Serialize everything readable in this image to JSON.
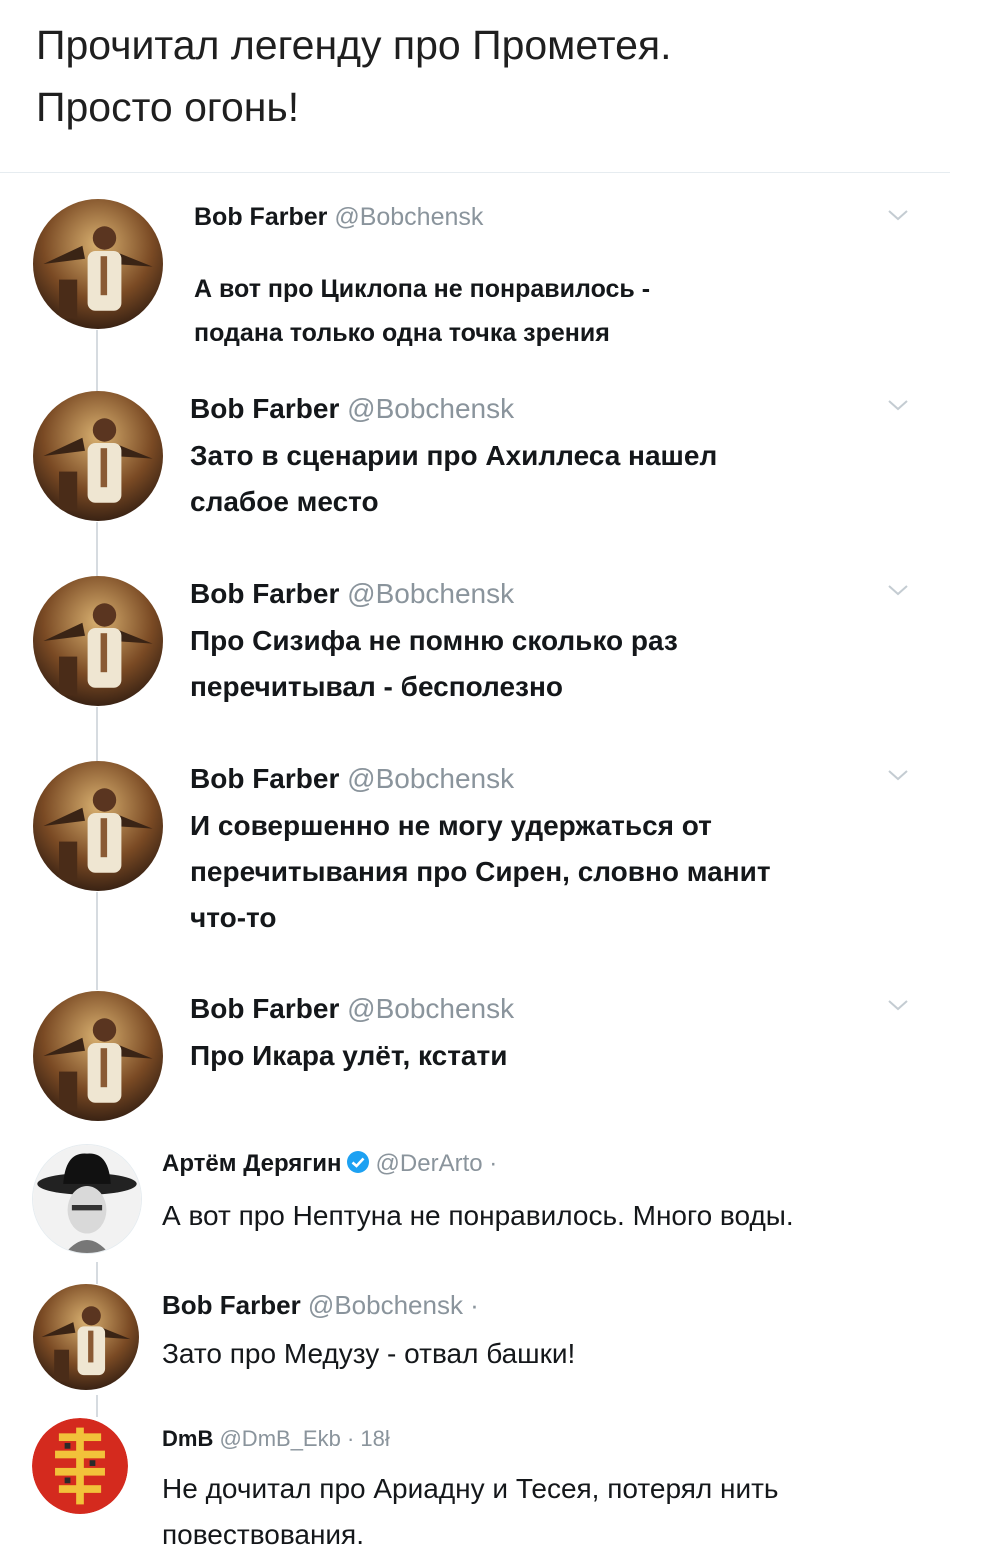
{
  "main_tweet": {
    "line1": "Прочитал легенду про Прометея.",
    "line2": "Просто огонь!"
  },
  "replies": [
    {
      "author": "Bob Farber",
      "handle": "@Bobchensk",
      "text_lines": [
        "А вот про Циклопа не понравилось -",
        "подана только одна точка зрения"
      ]
    },
    {
      "author": "Bob Farber",
      "handle": "@Bobchensk",
      "text_lines": [
        "Зато в сценарии про Ахиллеса нашел",
        "слабое место"
      ]
    },
    {
      "author": "Bob Farber",
      "handle": "@Bobchensk",
      "text_lines": [
        "Про Сизифа не помню сколько раз",
        "перечитывал - бесполезно"
      ]
    },
    {
      "author": "Bob Farber",
      "handle": "@Bobchensk",
      "text_lines": [
        "И совершенно не могу удержаться от",
        "перечитывания про Сирен, словно манит",
        "что-то"
      ]
    },
    {
      "author": "Bob Farber",
      "handle": "@Bobchensk",
      "text_lines": [
        "Про Икара улёт, кстати"
      ]
    },
    {
      "author": "Артём Дерягин",
      "handle": "@DerArto ·",
      "verified": true,
      "text_lines": [
        "А вот про Нептуна не понравилось. Много воды."
      ]
    },
    {
      "author": "Bob Farber",
      "handle": "@Bobchensk ·",
      "text_lines": [
        "Зато про  Медузу - отвал башки!"
      ]
    },
    {
      "author": "DmB",
      "handle": "@DmB_Ekb · 18ł",
      "text_lines": [
        "Не дочитал про Ариадну и Тесея, потерял нить",
        "повествования."
      ]
    }
  ],
  "icons": {
    "chevron": "chevron-down-icon",
    "verified": "verified-badge-icon",
    "avatar_bob": "avatar-photo-icon",
    "avatar_artem": "avatar-cowboy-icon",
    "avatar_dmb": "avatar-emblem-icon"
  },
  "colors": {
    "text": "#14171a",
    "handle": "#8a949c",
    "verified": "#1da1f2",
    "thread_line": "#d6dbe0",
    "dmb_avatar_bg": "#d42a1e",
    "dmb_emblem": "#f2c23a"
  }
}
